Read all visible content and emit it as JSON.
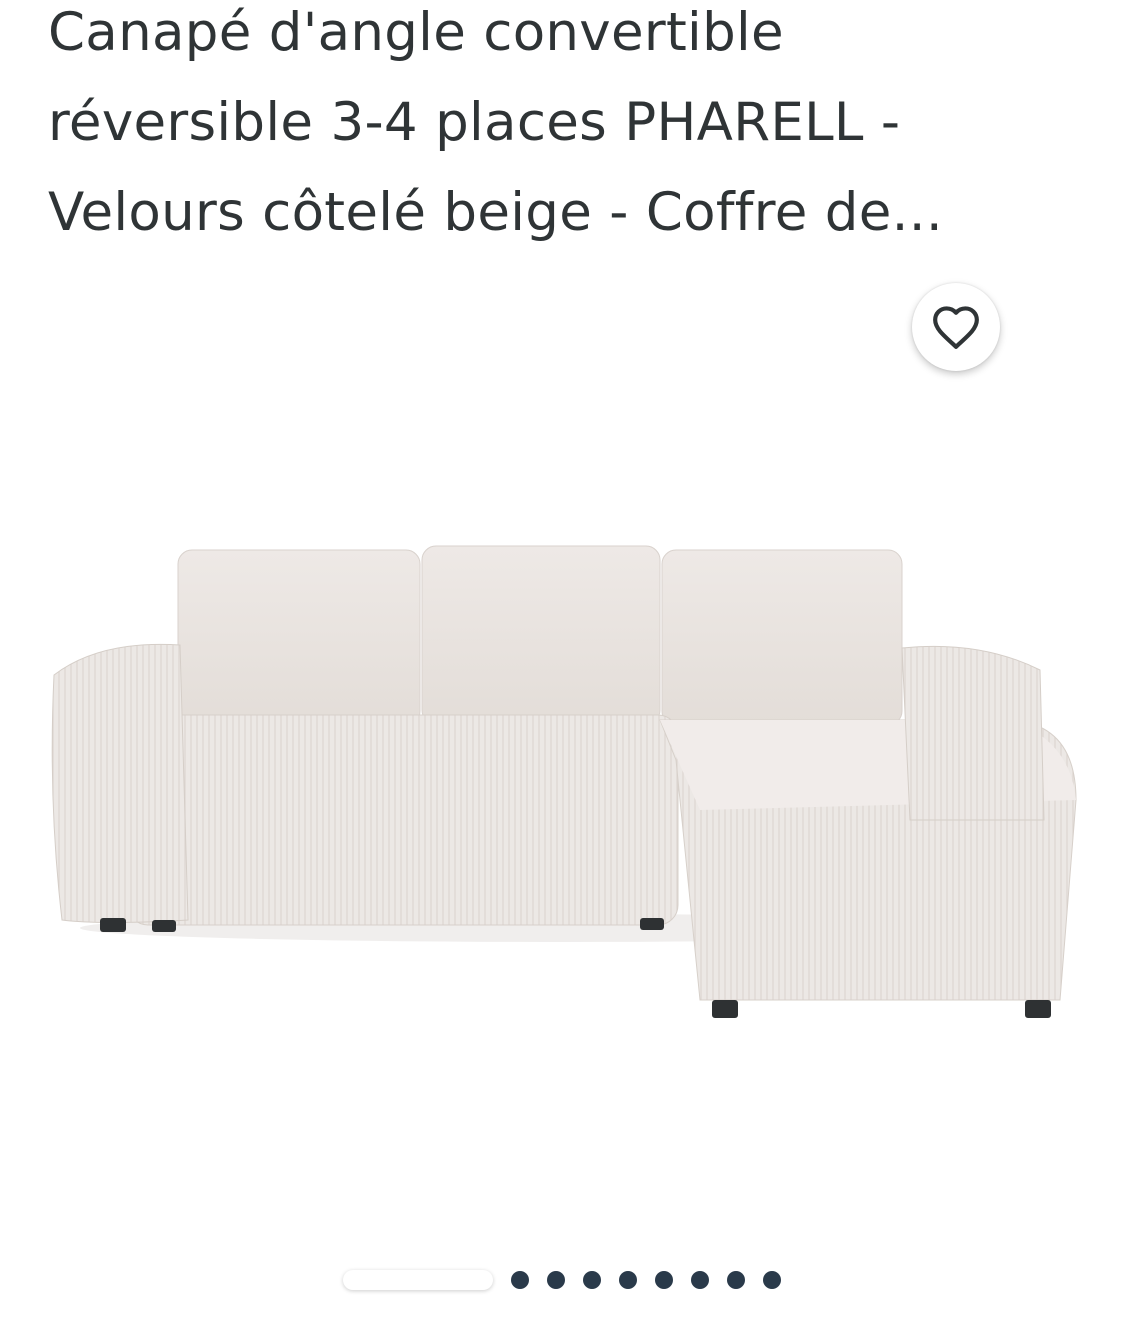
{
  "product": {
    "title_lines": [
      "Canapé d'angle convertible",
      "réversible 3-4 places PHARELL -",
      "Velours côtelé beige - Coffre de..."
    ]
  },
  "favorite": {
    "icon": "heart-outline-icon"
  },
  "gallery": {
    "total_images": 9,
    "active_index": 0
  },
  "colors": {
    "text": "#2f3436",
    "dot": "#2a3a4a",
    "sofa": "#ece7e3"
  }
}
